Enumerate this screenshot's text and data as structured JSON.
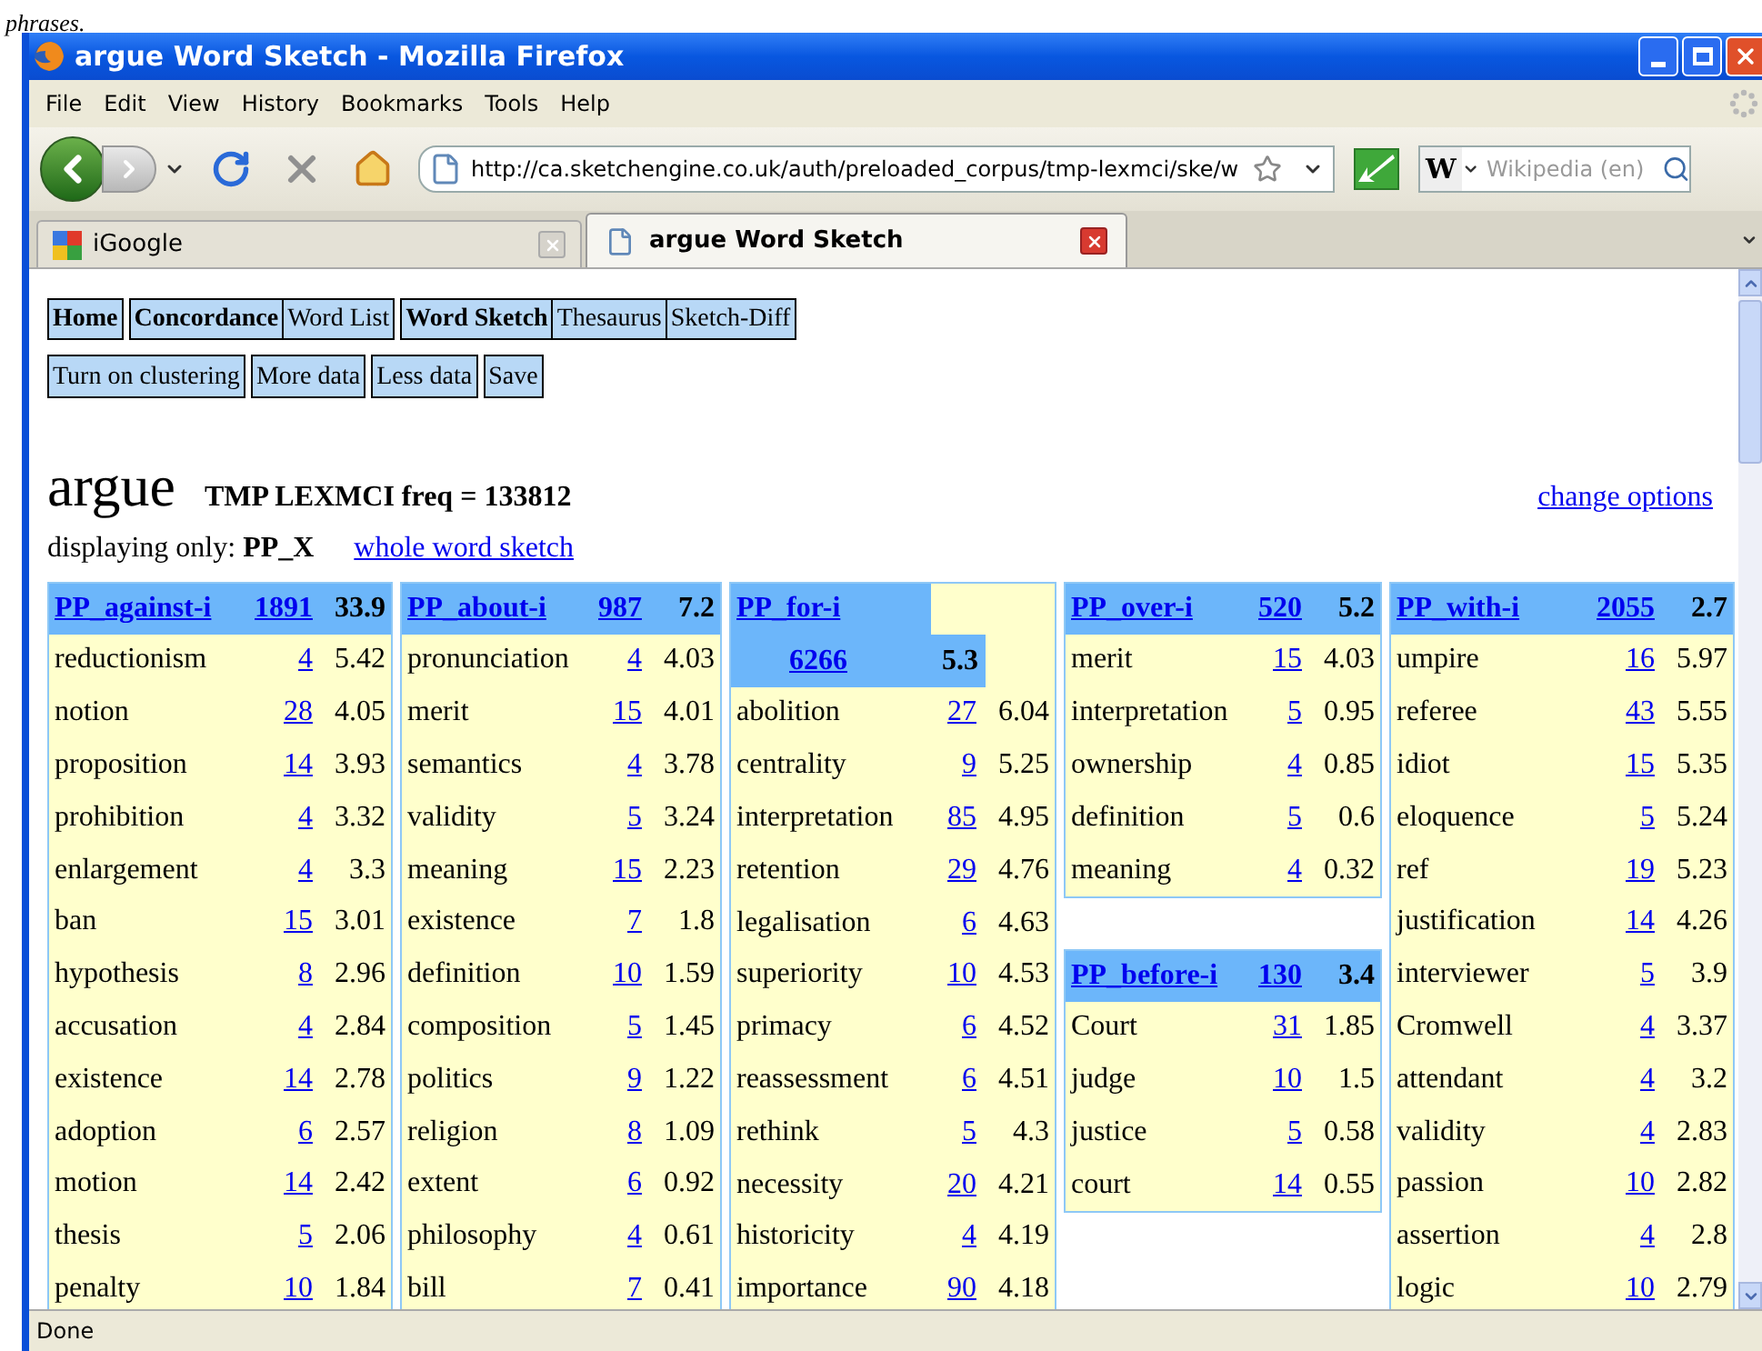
{
  "caption_fragment": "phrases.",
  "window": {
    "title": "argue Word Sketch - Mozilla Firefox"
  },
  "menu": [
    "File",
    "Edit",
    "View",
    "History",
    "Bookmarks",
    "Tools",
    "Help"
  ],
  "address_bar": {
    "value": "http://ca.sketchengine.co.uk/auth/preloaded_corpus/tmp-lexmci/ske/w"
  },
  "search": {
    "engine": "W",
    "placeholder": "Wikipedia (en)"
  },
  "tabs": [
    {
      "label": "iGoogle",
      "selected": false
    },
    {
      "label": "argue Word Sketch",
      "selected": true
    }
  ],
  "page": {
    "nav_groups": [
      [
        {
          "label": "Home",
          "bold": true
        }
      ],
      [
        {
          "label": "Concordance",
          "bold": true
        },
        {
          "label": "Word List",
          "bold": false
        }
      ],
      [
        {
          "label": "Word Sketch",
          "bold": true
        },
        {
          "label": "Thesaurus",
          "bold": false
        },
        {
          "label": "Sketch-Diff",
          "bold": false
        }
      ]
    ],
    "action_buttons": [
      "Turn on clustering",
      "More data",
      "Less data",
      "Save"
    ],
    "headword": "argue",
    "freq_line": "TMP LEXMCI freq = 133812",
    "change_options": "change options",
    "displaying": "displaying only: **PP_X**",
    "whole_word_sketch": "whole word sketch",
    "columns": [
      [
        {
          "label": "PP_against-i",
          "count": "1891",
          "score": "33.9",
          "kind": "single",
          "rows": [
            {
              "word": "reductionism",
              "count": "4",
              "score": "5.42"
            },
            {
              "word": "notion",
              "count": "28",
              "score": "4.05"
            },
            {
              "word": "proposition",
              "count": "14",
              "score": "3.93"
            },
            {
              "word": "prohibition",
              "count": "4",
              "score": "3.32"
            },
            {
              "word": "enlargement",
              "count": "4",
              "score": "3.3"
            },
            {
              "word": "ban",
              "count": "15",
              "score": "3.01"
            },
            {
              "word": "hypothesis",
              "count": "8",
              "score": "2.96"
            },
            {
              "word": "accusation",
              "count": "4",
              "score": "2.84"
            },
            {
              "word": "existence",
              "count": "14",
              "score": "2.78"
            },
            {
              "word": "adoption",
              "count": "6",
              "score": "2.57"
            },
            {
              "word": "motion",
              "count": "14",
              "score": "2.42"
            },
            {
              "word": "thesis",
              "count": "5",
              "score": "2.06"
            },
            {
              "word": "penalty",
              "count": "10",
              "score": "1.84"
            }
          ]
        }
      ],
      [
        {
          "label": "PP_about-i",
          "count": "987",
          "score": "7.2",
          "kind": "single",
          "rows": [
            {
              "word": "pronunciation",
              "count": "4",
              "score": "4.03"
            },
            {
              "word": "merit",
              "count": "15",
              "score": "4.01"
            },
            {
              "word": "semantics",
              "count": "4",
              "score": "3.78"
            },
            {
              "word": "validity",
              "count": "5",
              "score": "3.24"
            },
            {
              "word": "meaning",
              "count": "15",
              "score": "2.23"
            },
            {
              "word": "existence",
              "count": "7",
              "score": "1.8"
            },
            {
              "word": "definition",
              "count": "10",
              "score": "1.59"
            },
            {
              "word": "composition",
              "count": "5",
              "score": "1.45"
            },
            {
              "word": "politics",
              "count": "9",
              "score": "1.22"
            },
            {
              "word": "religion",
              "count": "8",
              "score": "1.09"
            },
            {
              "word": "extent",
              "count": "6",
              "score": "0.92"
            },
            {
              "word": "philosophy",
              "count": "4",
              "score": "0.61"
            },
            {
              "word": "bill",
              "count": "7",
              "score": "0.41"
            }
          ]
        }
      ],
      [
        {
          "label": "PP_for-i",
          "count": "6266",
          "score": "5.3",
          "kind": "wrapped",
          "rows": [
            {
              "word": "abolition",
              "count": "27",
              "score": "6.04"
            },
            {
              "word": "centrality",
              "count": "9",
              "score": "5.25"
            },
            {
              "word": "interpretation",
              "count": "85",
              "score": "4.95"
            },
            {
              "word": "retention",
              "count": "29",
              "score": "4.76"
            },
            {
              "word": "legalisation",
              "count": "6",
              "score": "4.63"
            },
            {
              "word": "superiority",
              "count": "10",
              "score": "4.53"
            },
            {
              "word": "primacy",
              "count": "6",
              "score": "4.52"
            },
            {
              "word": "reassessment",
              "count": "6",
              "score": "4.51"
            },
            {
              "word": "rethink",
              "count": "5",
              "score": "4.3"
            },
            {
              "word": "necessity",
              "count": "20",
              "score": "4.21"
            },
            {
              "word": "historicity",
              "count": "4",
              "score": "4.19"
            },
            {
              "word": "importance",
              "count": "90",
              "score": "4.18"
            }
          ]
        }
      ],
      [
        {
          "label": "PP_over-i",
          "count": "520",
          "score": "5.2",
          "kind": "single",
          "rows": [
            {
              "word": "merit",
              "count": "15",
              "score": "4.03"
            },
            {
              "word": "interpretation",
              "count": "5",
              "score": "0.95"
            },
            {
              "word": "ownership",
              "count": "4",
              "score": "0.85"
            },
            {
              "word": "definition",
              "count": "5",
              "score": "0.6"
            },
            {
              "word": "meaning",
              "count": "4",
              "score": "0.32"
            }
          ]
        },
        {
          "label": "PP_before-i",
          "count": "130",
          "score": "3.4",
          "kind": "single",
          "rows": [
            {
              "word": "Court",
              "count": "31",
              "score": "1.85"
            },
            {
              "word": "judge",
              "count": "10",
              "score": "1.5"
            },
            {
              "word": "justice",
              "count": "5",
              "score": "0.58"
            },
            {
              "word": "court",
              "count": "14",
              "score": "0.55"
            }
          ]
        }
      ],
      [
        {
          "label": "PP_with-i",
          "count": "2055",
          "score": "2.7",
          "kind": "single",
          "rows": [
            {
              "word": "umpire",
              "count": "16",
              "score": "5.97"
            },
            {
              "word": "referee",
              "count": "43",
              "score": "5.55"
            },
            {
              "word": "idiot",
              "count": "15",
              "score": "5.35"
            },
            {
              "word": "eloquence",
              "count": "5",
              "score": "5.24"
            },
            {
              "word": "ref",
              "count": "19",
              "score": "5.23"
            },
            {
              "word": "justification",
              "count": "14",
              "score": "4.26"
            },
            {
              "word": "interviewer",
              "count": "5",
              "score": "3.9"
            },
            {
              "word": "Cromwell",
              "count": "4",
              "score": "3.37"
            },
            {
              "word": "attendant",
              "count": "4",
              "score": "3.2"
            },
            {
              "word": "validity",
              "count": "4",
              "score": "2.83"
            },
            {
              "word": "passion",
              "count": "10",
              "score": "2.82"
            },
            {
              "word": "assertion",
              "count": "4",
              "score": "2.8"
            },
            {
              "word": "logic",
              "count": "10",
              "score": "2.79"
            }
          ]
        }
      ]
    ]
  },
  "status_bar": "Done"
}
